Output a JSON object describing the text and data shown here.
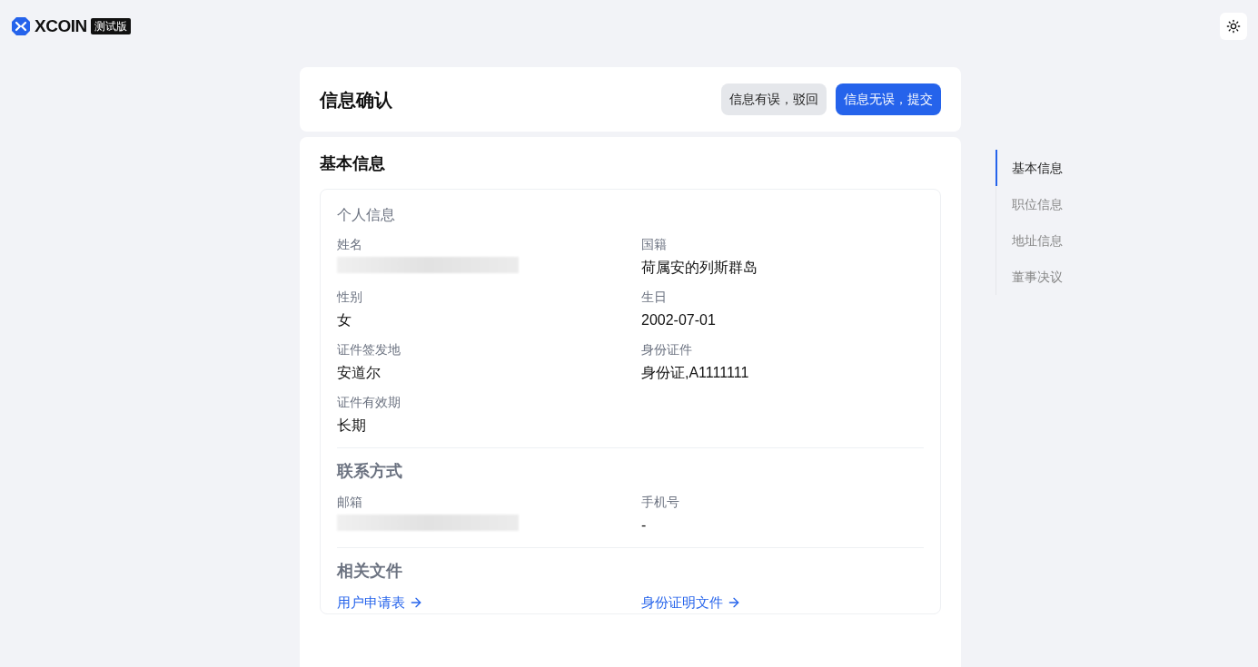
{
  "brand": {
    "name": "XCOIN",
    "badge": "测试版"
  },
  "header": {
    "title": "信息确认",
    "buttons": [
      {
        "label": "信息有误，驳回",
        "kind": "secondary"
      },
      {
        "label": "信息无误，提交",
        "kind": "primary"
      }
    ]
  },
  "section": {
    "title": "基本信息",
    "groups": [
      {
        "title": "个人信息",
        "fields": [
          {
            "label": "姓名",
            "kind": "redacted"
          },
          {
            "label": "国籍",
            "kind": "text",
            "value": "荷属安的列斯群岛"
          },
          {
            "label": "性别",
            "kind": "text",
            "value": "女"
          },
          {
            "label": "生日",
            "kind": "text",
            "value": "2002-07-01"
          },
          {
            "label": "证件签发地",
            "kind": "text",
            "value": "安道尔"
          },
          {
            "label": "身份证件",
            "kind": "text",
            "value": "身份证,A1111111"
          },
          {
            "label": "证件有效期",
            "kind": "text",
            "value": "长期"
          }
        ]
      },
      {
        "title": "联系方式",
        "fields": [
          {
            "label": "邮箱",
            "kind": "redacted"
          },
          {
            "label": "手机号",
            "kind": "text",
            "value": "-"
          }
        ]
      },
      {
        "title": "相关文件",
        "links": [
          "用户申请表",
          "身份证明文件"
        ]
      }
    ]
  },
  "nav": [
    {
      "label": "基本信息",
      "selected": true
    },
    {
      "label": "职位信息",
      "selected": false
    },
    {
      "label": "地址信息",
      "selected": false
    },
    {
      "label": "董事决议",
      "selected": false
    }
  ]
}
